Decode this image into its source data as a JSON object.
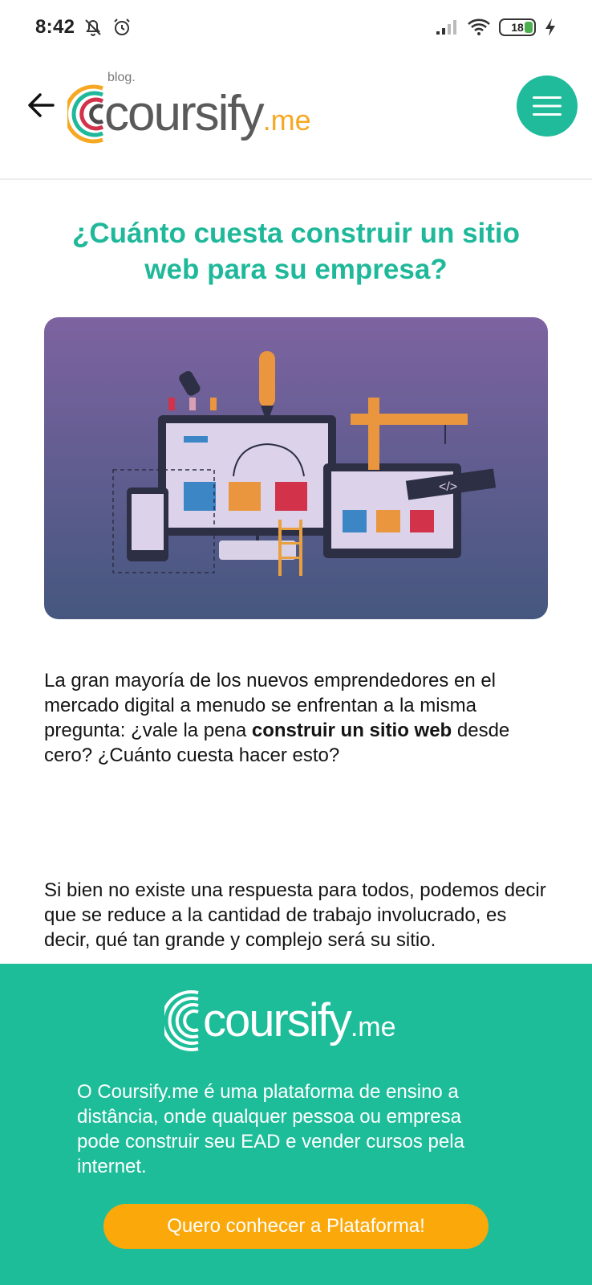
{
  "status_bar": {
    "time": "8:42",
    "battery": "18",
    "icons": [
      "bell-off-icon",
      "alarm-icon",
      "signal-icon",
      "wifi-icon",
      "battery-icon",
      "charging-icon"
    ]
  },
  "header": {
    "blog_label": "blog.",
    "logo_main": "coursify",
    "logo_suffix": ".me",
    "icons": [
      "back-arrow-icon",
      "hamburger-menu-icon"
    ]
  },
  "article": {
    "title": "¿Cuánto cuesta construir un sitio web para su empresa?",
    "p1_before": "La gran mayoría de los nuevos emprendedores en el mercado digital a menudo se enfrentan a la misma pregunta: ¿vale la pena ",
    "p1_bold": "construir un sitio web",
    "p1_after": " desde cero? ¿Cuánto cuesta hacer esto?",
    "p2": "Si bien no existe una respuesta para todos, podemos decir que se reduce a la cantidad de trabajo involucrado, es decir, qué tan grande y complejo será su sitio."
  },
  "banner": {
    "logo_main": "coursify",
    "logo_suffix": ".me",
    "text": "O Coursify.me é uma plataforma de ensino a distância, onde qualquer pessoa ou empresa\n pode construir seu EAD e vender cursos pela\n internet.",
    "cta_label": "Quero conhecer a Plataforma!"
  },
  "colors": {
    "brand_green": "#1fb89a",
    "cta_orange": "#fba80b",
    "logo_orange": "#f7a823"
  }
}
